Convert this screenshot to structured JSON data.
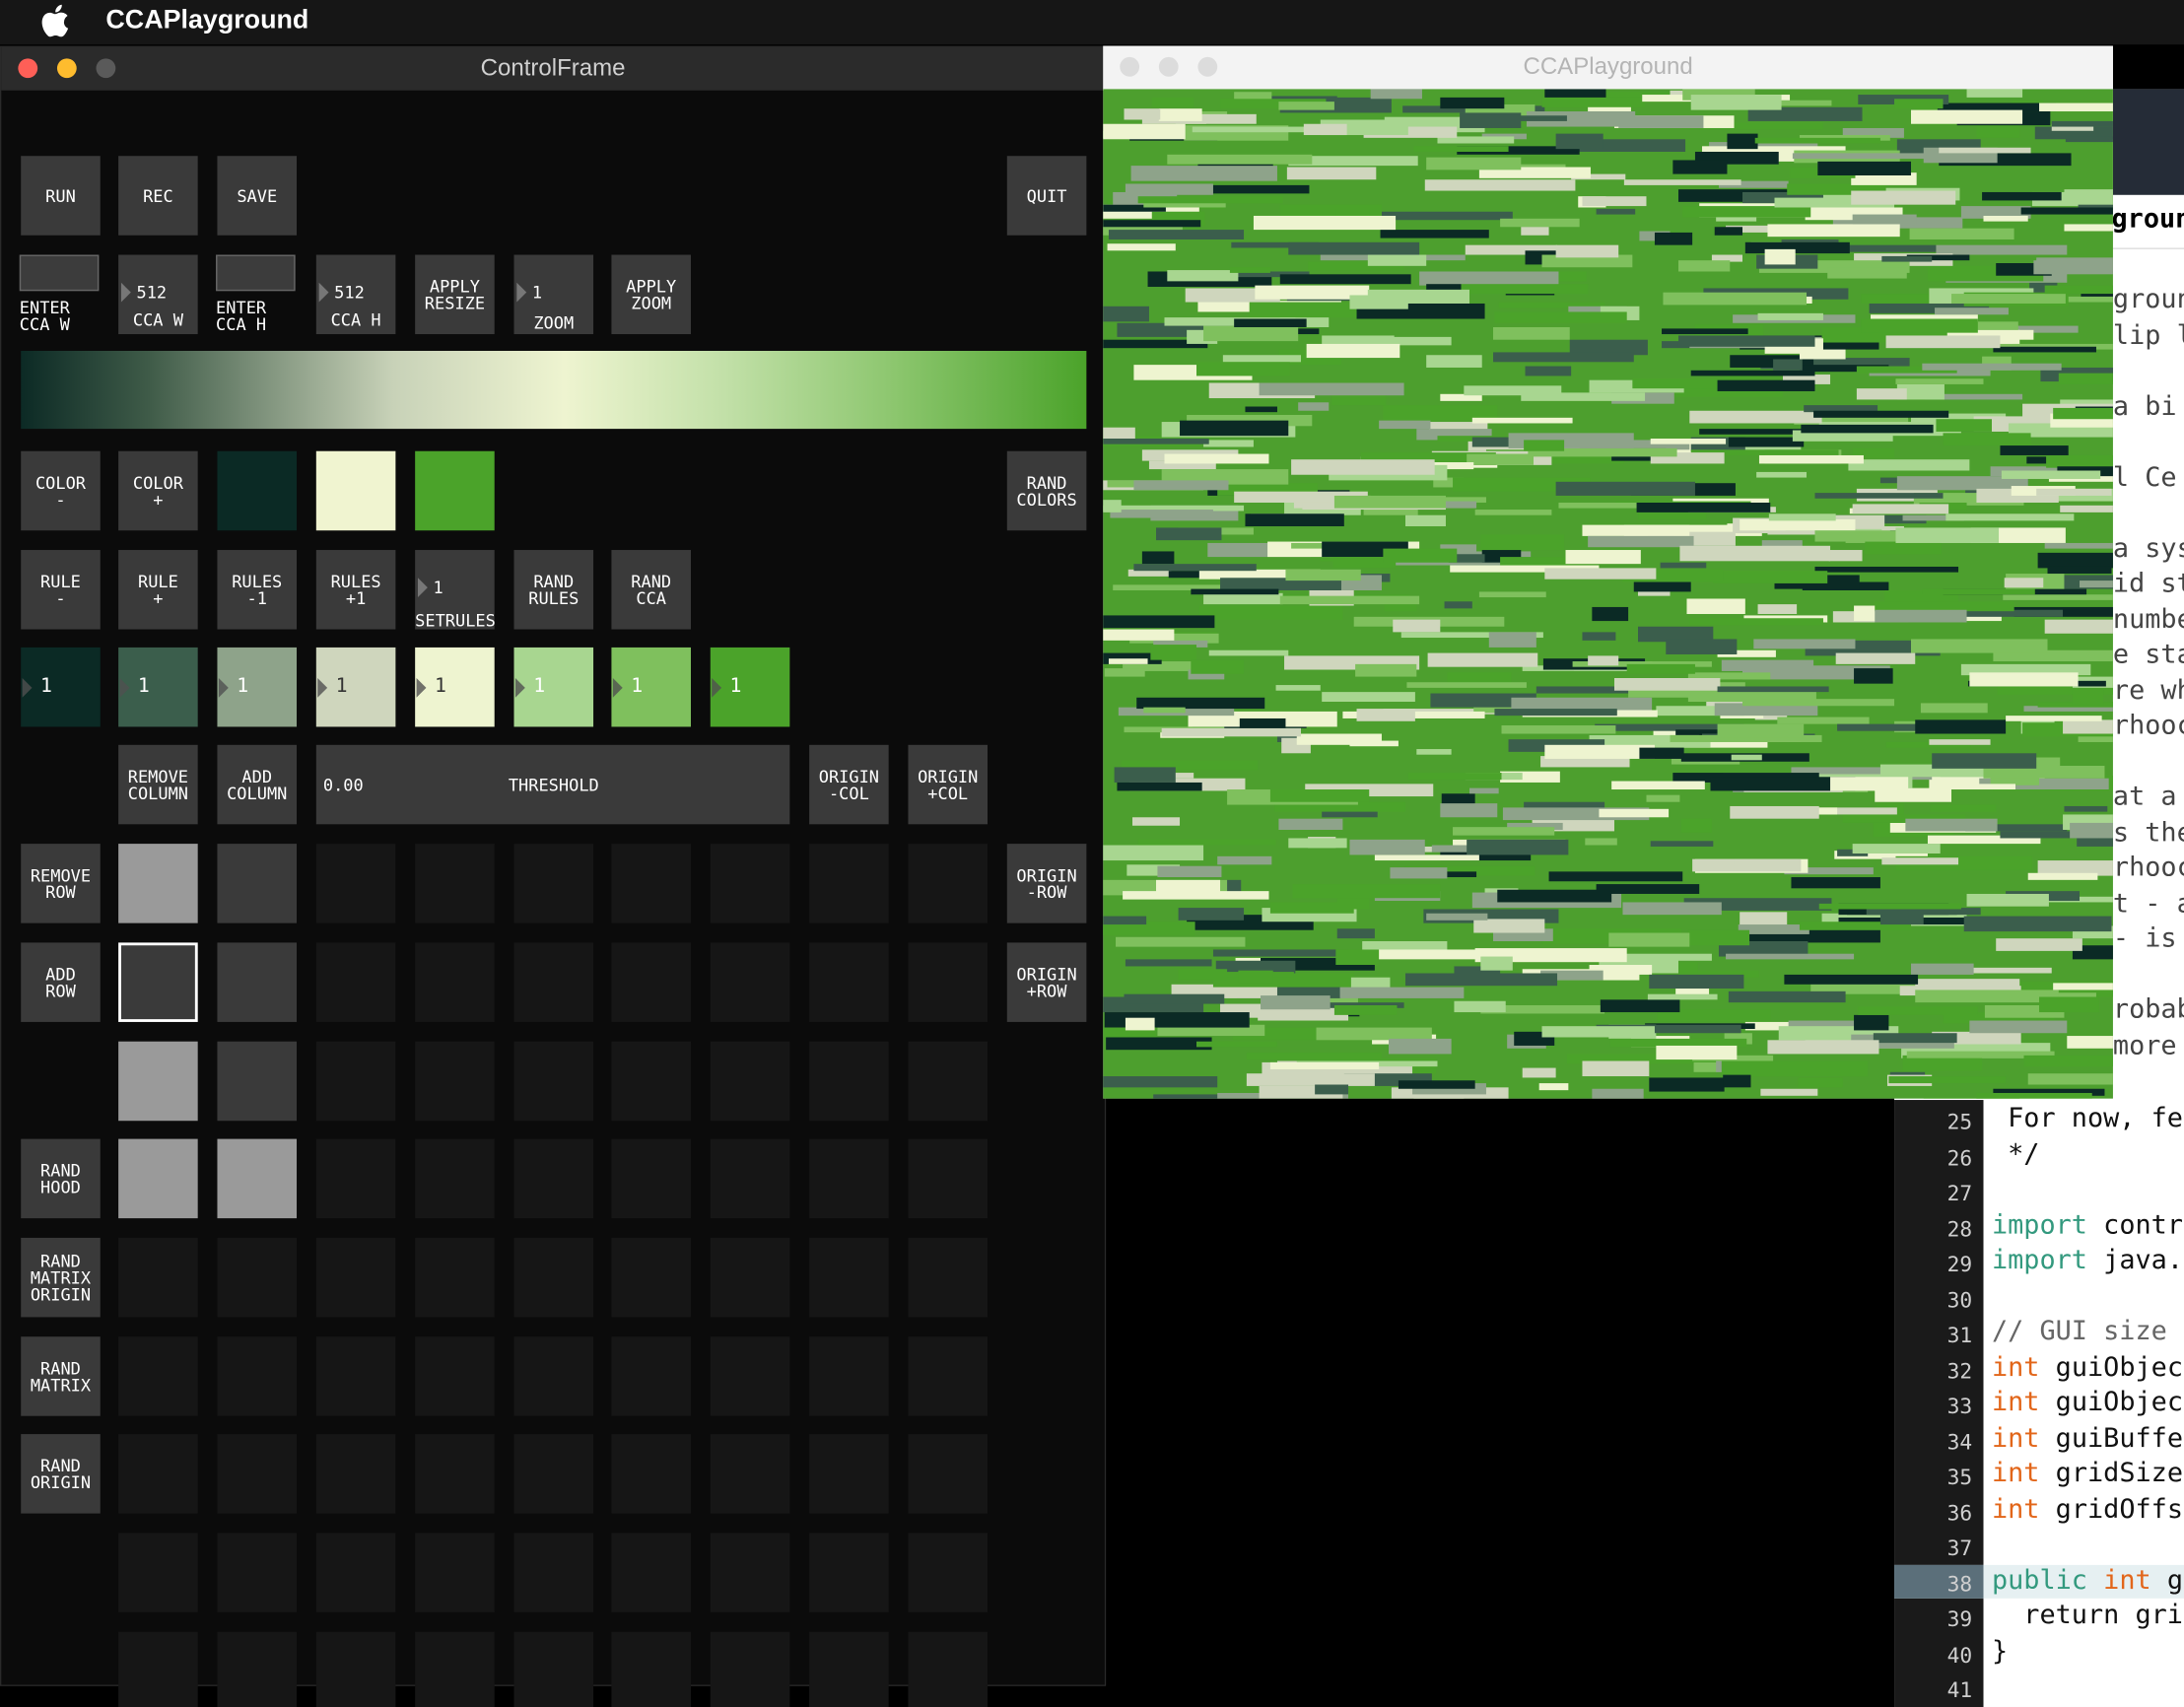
{
  "menubar": {
    "app_name": "CCAPlayground"
  },
  "control_frame": {
    "title": "ControlFrame",
    "run": "RUN",
    "rec": "REC",
    "save": "SAVE",
    "quit": "QUIT",
    "enter_ccaw_label": [
      "ENTER",
      "CCA W"
    ],
    "ccaw": {
      "value": "512",
      "label": "CCA W"
    },
    "enter_ccah_label": [
      "ENTER",
      "CCA H"
    ],
    "ccah": {
      "value": "512",
      "label": "CCA H"
    },
    "apply_resize": [
      "APPLY",
      "RESIZE"
    ],
    "zoom": {
      "value": "1",
      "label": "ZOOM"
    },
    "apply_zoom": [
      "APPLY",
      "ZOOM"
    ],
    "color_minus": [
      "COLOR",
      "-"
    ],
    "color_plus": [
      "COLOR",
      "+"
    ],
    "palette": [
      "#0b2a25",
      "#f0f4d0",
      "#4ba32a"
    ],
    "rand_colors": [
      "RAND",
      "COLORS"
    ],
    "rule_minus": [
      "RULE",
      "-"
    ],
    "rule_plus": [
      "RULE",
      "+"
    ],
    "rules_minus1": [
      "RULES",
      "-1"
    ],
    "rules_plus1": [
      "RULES",
      "+1"
    ],
    "setrules": {
      "value": "1",
      "label": "SETRULES"
    },
    "rand_rules": [
      "RAND",
      "RULES"
    ],
    "rand_cca": [
      "RAND",
      "CCA"
    ],
    "rule_values": [
      {
        "value": "1",
        "color": "#0b2a25",
        "text": "#ffffff"
      },
      {
        "value": "1",
        "color": "#3b5e4c",
        "text": "#ffffff"
      },
      {
        "value": "1",
        "color": "#8ea38a",
        "text": "#ffffff"
      },
      {
        "value": "1",
        "color": "#cfd6bd",
        "text": "#333333"
      },
      {
        "value": "1",
        "color": "#eef4d0",
        "text": "#333333"
      },
      {
        "value": "1",
        "color": "#a8d690",
        "text": "#ffffff"
      },
      {
        "value": "1",
        "color": "#7fc05d",
        "text": "#ffffff"
      },
      {
        "value": "1",
        "color": "#4ba32a",
        "text": "#ffffff"
      }
    ],
    "remove_column": [
      "REMOVE",
      "COLUMN"
    ],
    "add_column": [
      "ADD",
      "COLUMN"
    ],
    "threshold": {
      "value": "0.00",
      "label": "THRESHOLD"
    },
    "origin_minus_col": [
      "ORIGIN",
      "-COL"
    ],
    "origin_plus_col": [
      "ORIGIN",
      "+COL"
    ],
    "remove_row": [
      "REMOVE",
      "ROW"
    ],
    "origin_minus_row": [
      "ORIGIN",
      "-ROW"
    ],
    "add_row": [
      "ADD",
      "ROW"
    ],
    "origin_plus_row": [
      "ORIGIN",
      "+ROW"
    ],
    "rand_hood": [
      "RAND",
      "HOOD"
    ],
    "rand_matrix_origin": [
      "RAND",
      "MATRIX",
      "ORIGIN"
    ],
    "rand_matrix": [
      "RAND",
      "MATRIX"
    ],
    "rand_origin": [
      "RAND",
      "ORIGIN"
    ]
  },
  "cca_window": {
    "title": "CCAPlayground"
  },
  "editor": {
    "tab_title": "grounc",
    "partial_lines": [
      "groun",
      "lip l",
      "",
      "a bi",
      "",
      "l Ce",
      "",
      "a sys",
      "id st",
      "numbe",
      "e sta",
      "re wh",
      "rhooc",
      "",
      "at a",
      "s the",
      "rhooc",
      "t - a",
      "- is",
      "",
      "robab",
      "more"
    ],
    "lines": [
      {
        "n": "25",
        "code": " For now, fe"
      },
      {
        "n": "26",
        "code": " */"
      },
      {
        "n": "27",
        "code": ""
      },
      {
        "n": "28",
        "code": "import contro"
      },
      {
        "n": "29",
        "code": "import java.u"
      },
      {
        "n": "30",
        "code": ""
      },
      {
        "n": "31",
        "code": "// GUI size v"
      },
      {
        "n": "32",
        "code": "int guiObject"
      },
      {
        "n": "33",
        "code": "int guiObject"
      },
      {
        "n": "34",
        "code": "int guiBuffe"
      },
      {
        "n": "35",
        "code": "int gridSize"
      },
      {
        "n": "36",
        "code": "int gridOffs"
      },
      {
        "n": "37",
        "code": ""
      },
      {
        "n": "38",
        "code": "public int g"
      },
      {
        "n": "39",
        "code": "  return grid"
      },
      {
        "n": "40",
        "code": "}"
      },
      {
        "n": "41",
        "code": ""
      }
    ]
  }
}
